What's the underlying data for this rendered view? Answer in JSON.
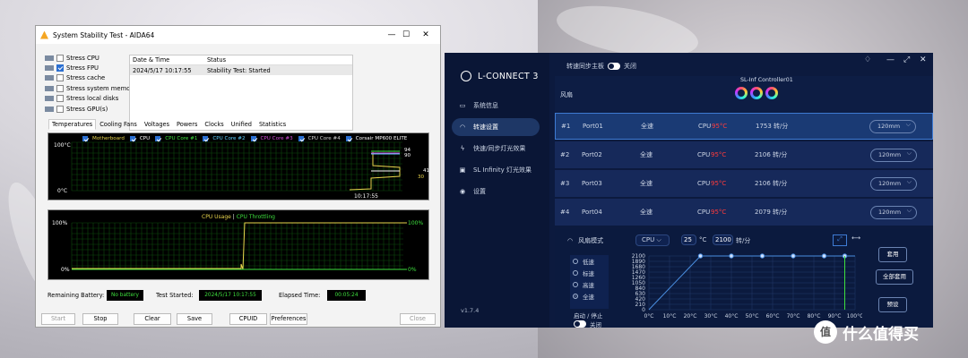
{
  "aida": {
    "title": "System Stability Test - AIDA64",
    "options": [
      {
        "label": "Stress CPU",
        "checked": false
      },
      {
        "label": "Stress FPU",
        "checked": true
      },
      {
        "label": "Stress cache",
        "checked": false
      },
      {
        "label": "Stress system memory",
        "checked": false
      },
      {
        "label": "Stress local disks",
        "checked": false
      },
      {
        "label": "Stress GPU(s)",
        "checked": false
      }
    ],
    "log_headers": [
      "Date & Time",
      "Status"
    ],
    "log_rows": [
      {
        "time": "2024/5/17 10:17:55",
        "status": "Stability Test: Started"
      }
    ],
    "tabs": [
      "Temperatures",
      "Cooling Fans",
      "Voltages",
      "Powers",
      "Clocks",
      "Unified",
      "Statistics"
    ],
    "temp_legend": [
      {
        "label": "Motherboard",
        "color": "#e8d44d"
      },
      {
        "label": "CPU",
        "color": "#ffffff"
      },
      {
        "label": "CPU Core #1",
        "color": "#3ee03e"
      },
      {
        "label": "CPU Core #2",
        "color": "#5fd0ff"
      },
      {
        "label": "CPU Core #3",
        "color": "#d44ddb"
      },
      {
        "label": "CPU Core #4",
        "color": "#cfcfcf"
      },
      {
        "label": "Corsair MP600 ELITE",
        "color": "#ffffff"
      }
    ],
    "temp_ymax": "100°C",
    "temp_ymin": "0°C",
    "temp_time": "10:17:55",
    "temp_values": [
      "94",
      "90",
      "41",
      "30"
    ],
    "usage_title_a": "CPU Usage",
    "usage_sep": "|",
    "usage_title_b": "CPU Throttling",
    "usage_ymax_l": "100%",
    "usage_ymin_l": "0%",
    "usage_ymax_r": "100%",
    "usage_ymin_r": "0%",
    "status": {
      "battery_label": "Remaining Battery:",
      "battery_value": "No battery",
      "started_label": "Test Started:",
      "started_value": "2024/5/17 10:17:55",
      "elapsed_label": "Elapsed Time:",
      "elapsed_value": "00:05:24"
    },
    "buttons": {
      "start": "Start",
      "stop": "Stop",
      "clear": "Clear",
      "save": "Save",
      "cpuid": "CPUID",
      "prefs": "Preferences",
      "close": "Close"
    }
  },
  "lc": {
    "app_name": "L-CONNECT 3",
    "sync_label": "转速同步主板",
    "sync_state": "关闭",
    "nav": [
      {
        "label": "系统信息",
        "icon": "monitor-icon",
        "glyph": "▭"
      },
      {
        "label": "转速设置",
        "icon": "fan-speed-icon",
        "glyph": "◠"
      },
      {
        "label": "快速/同步灯光效果",
        "icon": "lightning-icon",
        "glyph": "ϟ"
      },
      {
        "label": "SL Infinity 灯光效果",
        "icon": "infinity-icon",
        "glyph": "▣"
      },
      {
        "label": "设置",
        "icon": "settings-icon",
        "glyph": "◉"
      }
    ],
    "version": "v1.7.4",
    "fan_col": "风扇",
    "controller": "SL-Inf Controller01",
    "ports": [
      {
        "num": "#1",
        "name": "Port01",
        "mode": "全速",
        "src": "CPU",
        "temp": "95°C",
        "rpm": "1753 转/分",
        "size": "120mm"
      },
      {
        "num": "#2",
        "name": "Port02",
        "mode": "全速",
        "src": "CPU",
        "temp": "95°C",
        "rpm": "2106 转/分",
        "size": "120mm"
      },
      {
        "num": "#3",
        "name": "Port03",
        "mode": "全速",
        "src": "CPU",
        "temp": "95°C",
        "rpm": "2106 转/分",
        "size": "120mm"
      },
      {
        "num": "#4",
        "name": "Port04",
        "mode": "全速",
        "src": "CPU",
        "temp": "95°C",
        "rpm": "2079 转/分",
        "size": "120mm"
      }
    ],
    "fan_mode_label": "风扇模式",
    "curve_src": "CPU",
    "curve_temp": "25",
    "curve_temp_unit": "°C",
    "curve_rpm": "2100",
    "curve_rpm_unit": "转/分",
    "modes": [
      {
        "label": "低速",
        "on": false
      },
      {
        "label": "标速",
        "on": false
      },
      {
        "label": "高速",
        "on": false
      },
      {
        "label": "全速",
        "on": true
      }
    ],
    "start_stop": "启动 / 停止",
    "start_stop_state": "关闭",
    "apply": "套用",
    "apply_all": "全部套用",
    "preset": "预设",
    "y_ticks": [
      "2100",
      "1890",
      "1680",
      "1470",
      "1260",
      "1050",
      "840",
      "630",
      "420",
      "210",
      "0"
    ],
    "x_ticks": [
      "0°C",
      "10°C",
      "20°C",
      "30°C",
      "40°C",
      "50°C",
      "60°C",
      "70°C",
      "80°C",
      "90°C",
      "100°C"
    ],
    "curve_points": [
      [
        0,
        0
      ],
      [
        25,
        2100
      ],
      [
        40,
        2100
      ],
      [
        55,
        2100
      ],
      [
        70,
        2100
      ],
      [
        85,
        2100
      ],
      [
        95,
        2100
      ]
    ],
    "current_temp": 95
  },
  "watermark": {
    "icon": "值",
    "text": "什么值得买"
  }
}
